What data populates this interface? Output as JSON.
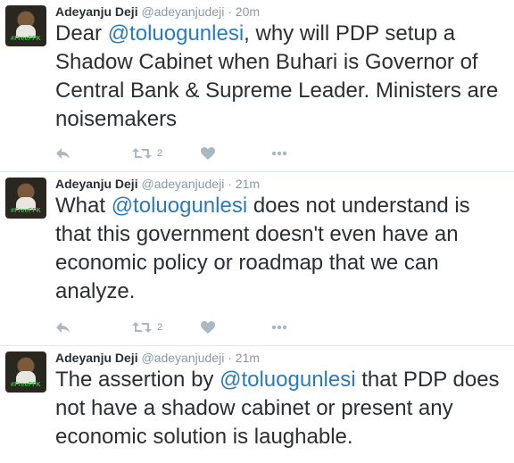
{
  "tweets": [
    {
      "name": "Adeyanju Deji",
      "handle": "@adeyanjudeji",
      "separator": "·",
      "time": "20m",
      "text_before": "Dear ",
      "mention": "@toluogunlesi",
      "text_after": ", why will PDP setup a Shadow Cabinet when Buhari is Governor of Central Bank & Supreme Leader. Ministers are noisemakers",
      "retweet_count": "2",
      "avatar_tag": "#FreeFFK"
    },
    {
      "name": "Adeyanju Deji",
      "handle": "@adeyanjudeji",
      "separator": "·",
      "time": "21m",
      "text_before": "What ",
      "mention": "@toluogunlesi",
      "text_after": " does not understand is that this government doesn't even have an economic policy or roadmap that we can analyze.",
      "retweet_count": "2",
      "avatar_tag": "#FreeFFK"
    },
    {
      "name": "Adeyanju Deji",
      "handle": "@adeyanjudeji",
      "separator": "·",
      "time": "21m",
      "text_before": "The assertion by ",
      "mention": "@toluogunlesi",
      "text_after": " that PDP does not have a shadow cabinet or present any economic solution is laughable.",
      "retweet_count": "",
      "avatar_tag": "#FreeFFK"
    }
  ],
  "icons": {
    "reply": "reply-icon",
    "retweet": "retweet-icon",
    "like": "heart-icon",
    "more": "more-icon"
  },
  "colors": {
    "mention": "#2b7bb9",
    "meta": "#8899a6",
    "text": "#292f33",
    "divider": "#e1e8ed"
  }
}
